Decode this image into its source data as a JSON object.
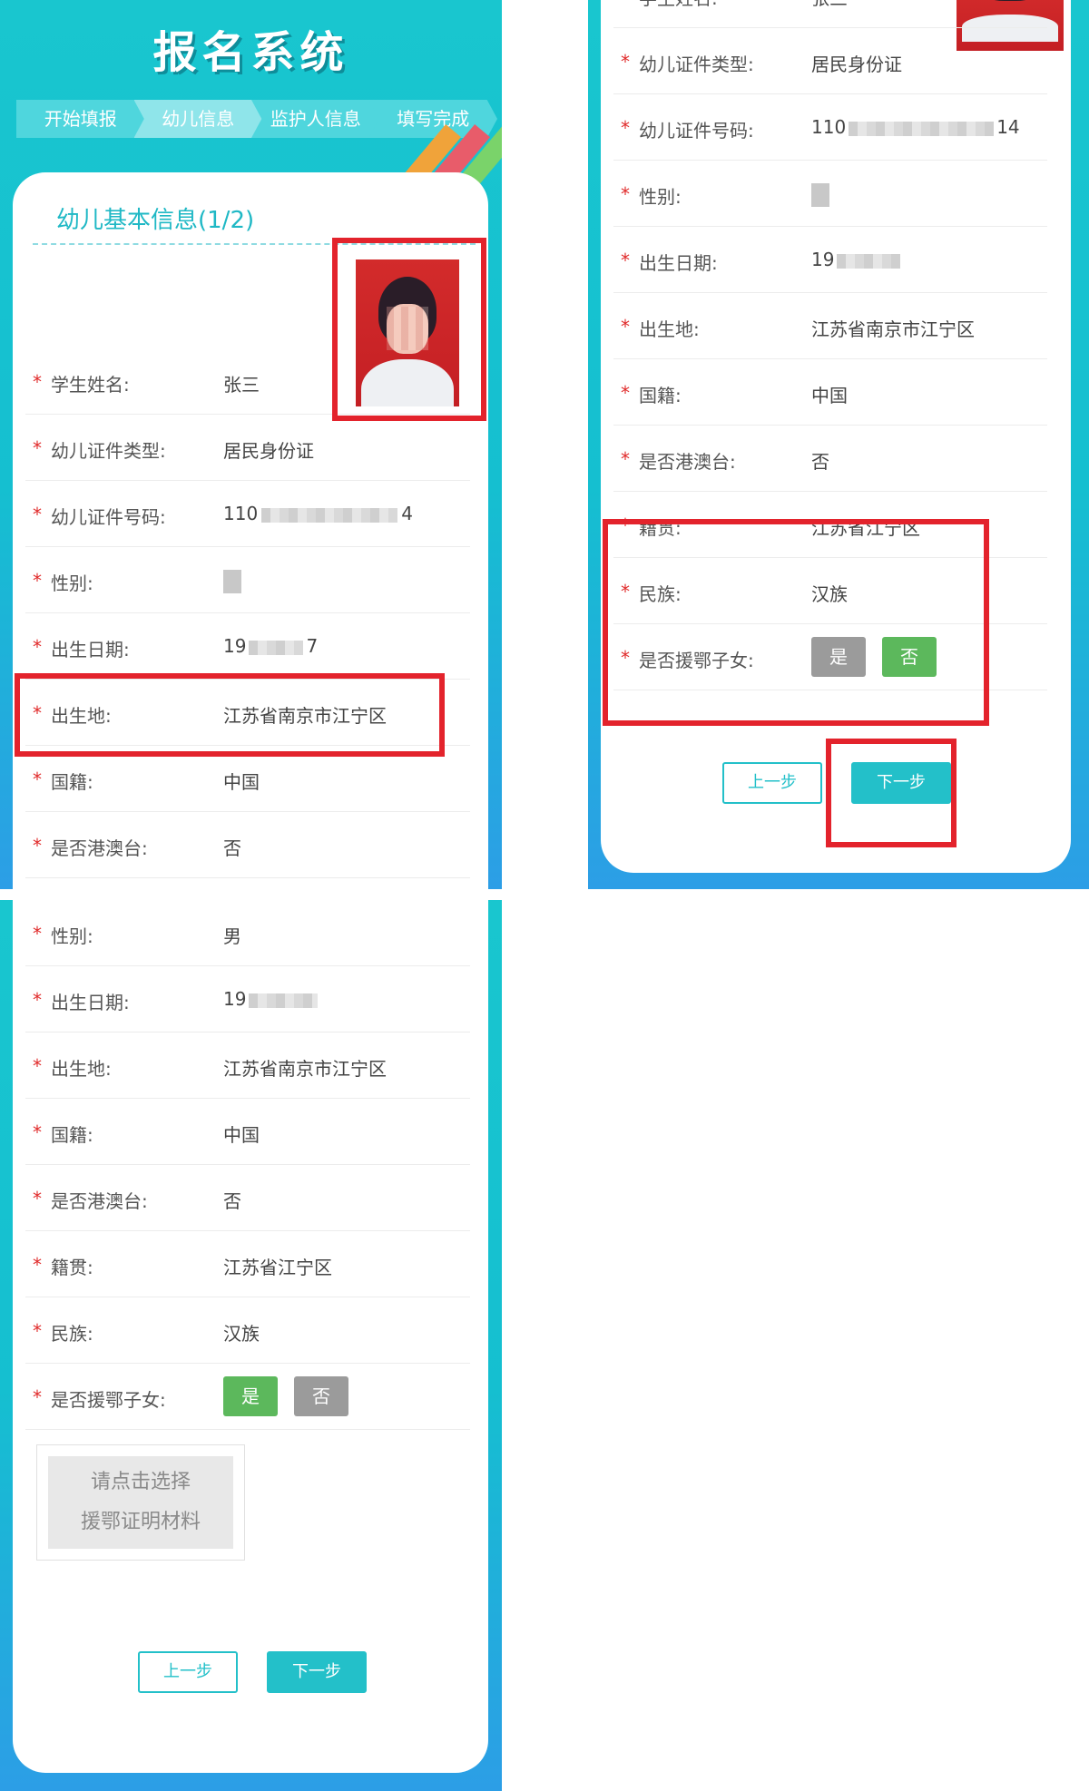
{
  "app": {
    "title": "报名系统",
    "steps": [
      "开始填报",
      "幼儿信息",
      "监护人信息",
      "填写完成"
    ]
  },
  "section": {
    "title": "幼儿基本信息(1/2)"
  },
  "fields": {
    "name": {
      "label": "学生姓名:",
      "value": "张三"
    },
    "id_type": {
      "label": "幼儿证件类型:",
      "value": "居民身份证"
    },
    "id_number": {
      "label": "幼儿证件号码:",
      "value_prefix": "110",
      "value_suffix_a": "4",
      "value_suffix_b": "14"
    },
    "gender": {
      "label": "性别:",
      "value": "男"
    },
    "birth_date": {
      "label": "出生日期:",
      "value_prefix_a": "19",
      "value_suffix_a": "7",
      "value_prefix_b": "19",
      "value_prefix_c": "19"
    },
    "birth_place": {
      "label": "出生地:",
      "value": "江苏省南京市江宁区"
    },
    "nationality": {
      "label": "国籍:",
      "value": "中国"
    },
    "hk_macau_tw": {
      "label": "是否港澳台:",
      "value": "否"
    },
    "native_place": {
      "label": "籍贯:",
      "value": "江苏省江宁区"
    },
    "ethnicity": {
      "label": "民族:",
      "value": "汉族"
    },
    "hubei_aid": {
      "label": "是否援鄂子女:",
      "yes": "是",
      "no": "否"
    }
  },
  "upload": {
    "line1": "请点击选择",
    "line2": "援鄂证明材料"
  },
  "buttons": {
    "prev": "上一步",
    "next": "下一步"
  },
  "colors": {
    "accent": "#23c0c9",
    "highlight": "#e3232c",
    "selected": "#5cb85c",
    "unselected": "#9b9b9b"
  }
}
